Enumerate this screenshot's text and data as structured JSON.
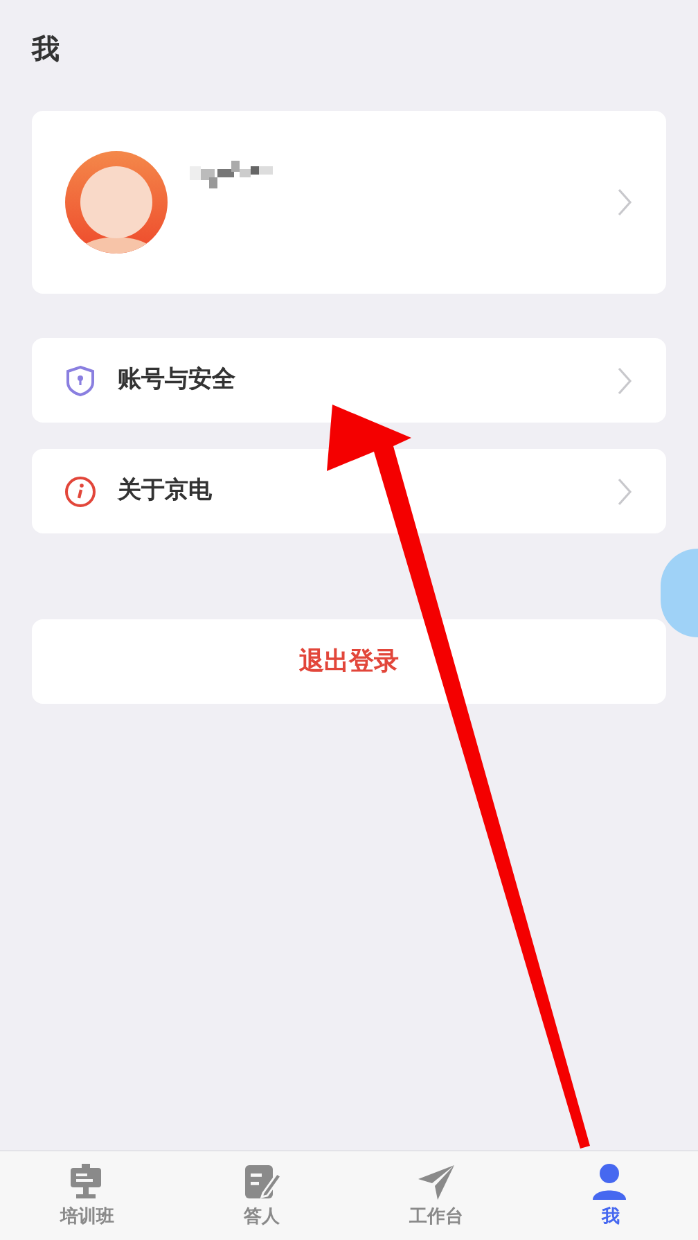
{
  "header": {
    "title": "我"
  },
  "profile": {
    "kind": "profile"
  },
  "menu": [
    {
      "label": "账号与安全",
      "kind": "shield"
    },
    {
      "label": "关于京电",
      "kind": "info"
    }
  ],
  "logout": {
    "label": "退出登录"
  },
  "tabs": [
    {
      "label": "培训班",
      "kind": "board",
      "selected": false
    },
    {
      "label": "答人",
      "kind": "note",
      "selected": false
    },
    {
      "label": "工作台",
      "kind": "plane",
      "selected": false
    },
    {
      "label": "我",
      "kind": "person",
      "selected": true
    }
  ]
}
